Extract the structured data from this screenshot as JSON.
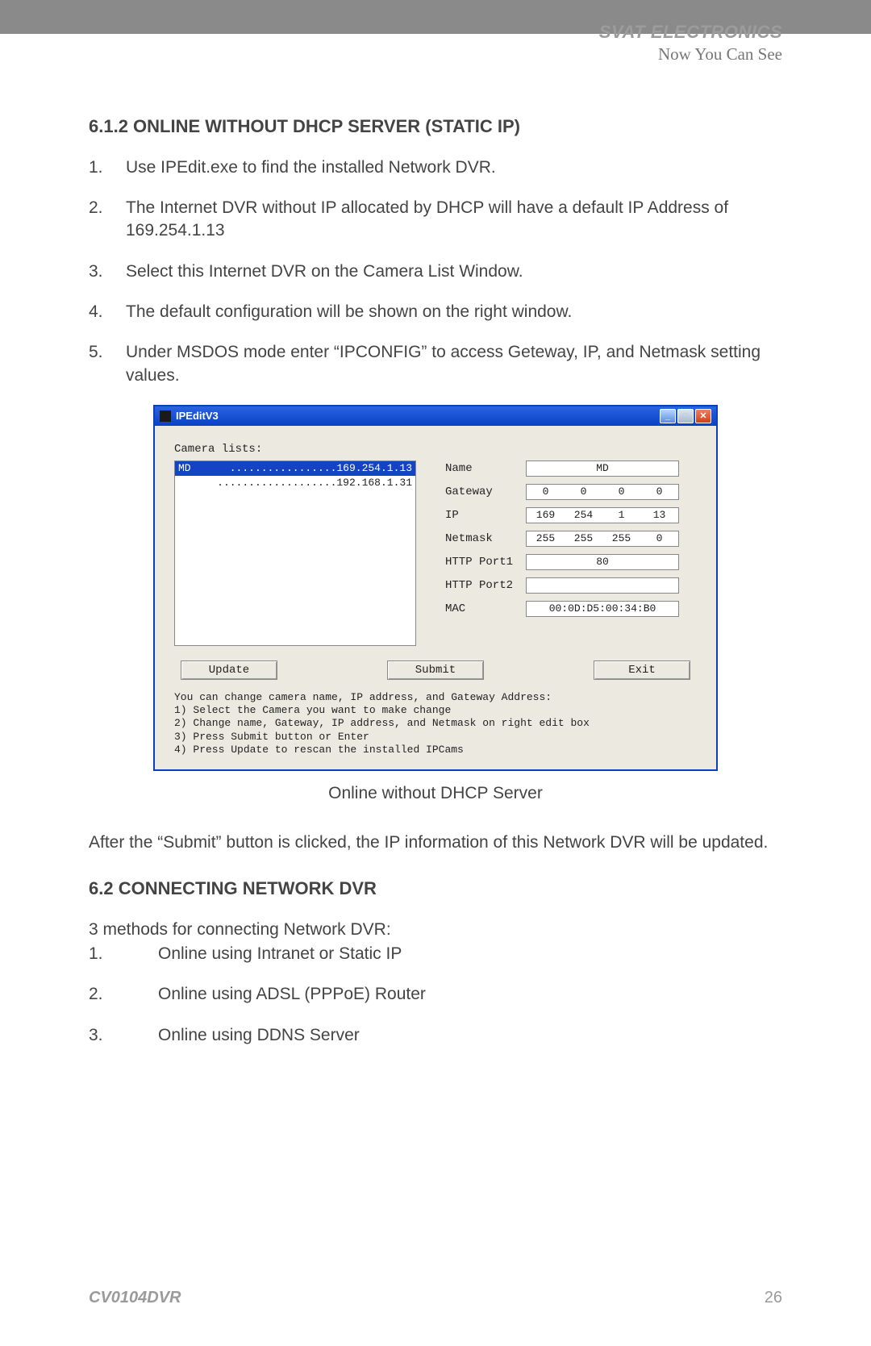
{
  "header": {
    "brand": "SVAT ELECTRONICS",
    "tagline": "Now You Can See"
  },
  "section1": {
    "title": "6.1.2 ONLINE WITHOUT DHCP SERVER (STATIC IP)",
    "steps": [
      "Use IPEdit.exe to find the installed Network DVR.",
      "The Internet DVR without IP allocated by DHCP will have a default IP Address of 169.254.1.13",
      "Select this Internet DVR on the Camera List Window.",
      "The default configuration will be shown on the right window.",
      "Under MSDOS mode enter “IPCONFIG” to access Geteway, IP, and Netmask setting values."
    ]
  },
  "window": {
    "title": "IPEditV3",
    "cameraListsLabel": "Camera lists:",
    "list": [
      {
        "name": "MD",
        "dots": ".................",
        "ip": "169.254.1.13",
        "selected": true
      },
      {
        "name": "",
        "dots": "...................",
        "ip": "192.168.1.31",
        "selected": false
      }
    ],
    "fields": {
      "nameLabel": "Name",
      "nameValue": "MD",
      "gatewayLabel": "Gateway",
      "gateway": [
        "0",
        "0",
        "0",
        "0"
      ],
      "ipLabel": "IP",
      "ip": [
        "169",
        "254",
        "1",
        "13"
      ],
      "netmaskLabel": "Netmask",
      "netmask": [
        "255",
        "255",
        "255",
        "0"
      ],
      "port1Label": "HTTP Port1",
      "port1Value": "80",
      "port2Label": "HTTP Port2",
      "port2Value": "",
      "macLabel": "MAC",
      "macValue": "00:0D:D5:00:34:B0"
    },
    "buttons": {
      "update": "Update",
      "submit": "Submit",
      "exit": "Exit"
    },
    "instructions": [
      "You can change camera name, IP address, and Gateway Address:",
      "1) Select the Camera you want to make change",
      "2) Change name, Gateway, IP address, and Netmask on right edit box",
      "3) Press Submit button or Enter",
      "4) Press Update to rescan the installed IPCams"
    ]
  },
  "caption": "Online without DHCP Server",
  "afterSubmit": "After the “Submit” button is clicked, the IP information of this Network DVR will be updated.",
  "section2": {
    "title": "6.2 CONNECTING NETWORK DVR",
    "intro": "3 methods for connecting Network DVR:",
    "methods": [
      "Online using Intranet or Static IP",
      "Online using ADSL (PPPoE) Router",
      "Online using DDNS Server"
    ]
  },
  "footer": {
    "model": "CV0104DVR",
    "page": "26"
  }
}
